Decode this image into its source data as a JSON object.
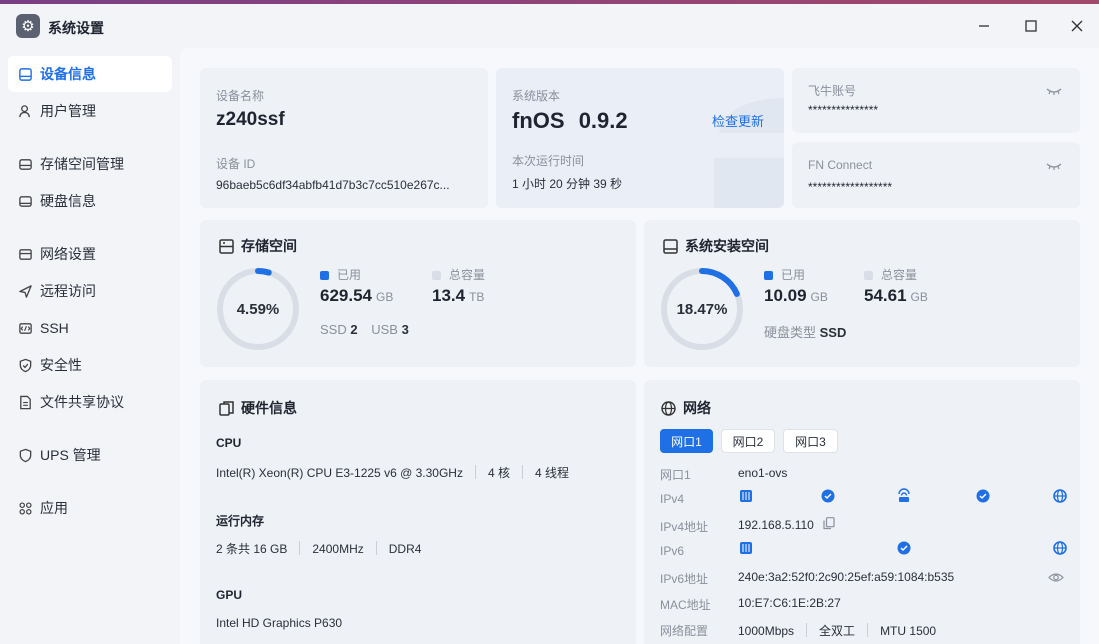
{
  "app": {
    "title": "系统设置"
  },
  "window_controls": {
    "minimize": "—",
    "maximize": "☐",
    "close": "✕"
  },
  "sidebar": {
    "items": [
      {
        "label": "设备信息",
        "icon": "device-icon",
        "active": true
      },
      {
        "label": "用户管理",
        "icon": "user-icon"
      },
      {
        "label": "存储空间管理",
        "icon": "storage-icon"
      },
      {
        "label": "硬盘信息",
        "icon": "disk-icon"
      },
      {
        "label": "网络设置",
        "icon": "network-settings-icon"
      },
      {
        "label": "远程访问",
        "icon": "remote-icon"
      },
      {
        "label": "SSH",
        "icon": "ssh-icon"
      },
      {
        "label": "安全性",
        "icon": "shield-icon"
      },
      {
        "label": "文件共享协议",
        "icon": "file-share-icon"
      },
      {
        "label": "UPS 管理",
        "icon": "ups-icon"
      },
      {
        "label": "应用",
        "icon": "apps-icon"
      }
    ]
  },
  "device": {
    "name_label": "设备名称",
    "name": "z240ssf",
    "id_label": "设备 ID",
    "id": "96baeb5c6df34abfb41d7b3c7cc510e267c..."
  },
  "system": {
    "version_label": "系统版本",
    "os": "fnOS",
    "version": "0.9.2",
    "check_update": "检查更新",
    "uptime_label": "本次运行时间",
    "uptime": "1 小时 20 分钟 39 秒"
  },
  "account": {
    "fn_label": "飞牛账号",
    "fn_value": "***************",
    "connect_label": "FN Connect",
    "connect_value": "******************"
  },
  "storage": {
    "title": "存储空间",
    "percent_text": "4.59%",
    "percent": 4.59,
    "used_label": "已用",
    "used_value": "629.54",
    "used_unit": "GB",
    "total_label": "总容量",
    "total_value": "13.4",
    "total_unit": "TB",
    "ssd_label": "SSD",
    "ssd_count": "2",
    "usb_label": "USB",
    "usb_count": "3"
  },
  "system_space": {
    "title": "系统安装空间",
    "percent_text": "18.47%",
    "percent": 18.47,
    "used_label": "已用",
    "used_value": "10.09",
    "used_unit": "GB",
    "total_label": "总容量",
    "total_value": "54.61",
    "total_unit": "GB",
    "disk_type_label": "硬盘类型",
    "disk_type": "SSD"
  },
  "hardware": {
    "title": "硬件信息",
    "cpu_label": "CPU",
    "cpu_model": "Intel(R) Xeon(R) CPU E3-1225 v6 @ 3.30GHz",
    "cpu_cores": "4 核",
    "cpu_threads": "4 线程",
    "mem_label": "运行内存",
    "mem_size": "2 条共 16 GB",
    "mem_freq": "2400MHz",
    "mem_type": "DDR4",
    "gpu_label": "GPU",
    "gpu_model": "Intel HD Graphics P630"
  },
  "network": {
    "title": "网络",
    "tabs": [
      "网口1",
      "网口2",
      "网口3"
    ],
    "port_label": "网口1",
    "port_value": "eno1-ovs",
    "ipv4_label": "IPv4",
    "ipv4_addr_label": "IPv4地址",
    "ipv4_addr": "192.168.5.110",
    "ipv6_label": "IPv6",
    "ipv6_addr_label": "IPv6地址",
    "ipv6_addr": "240e:3a2:52f0:2c90:25ef:a59:1084:b535",
    "mac_label": "MAC地址",
    "mac": "10:E7:C6:1E:2B:27",
    "config_label": "网络配置",
    "speed": "1000Mbps",
    "duplex": "全双工",
    "mtu": "MTU 1500"
  },
  "colors": {
    "accent": "#1f6fe5",
    "ring_track": "#d9dde5",
    "card_bg": "#eef1f5"
  }
}
